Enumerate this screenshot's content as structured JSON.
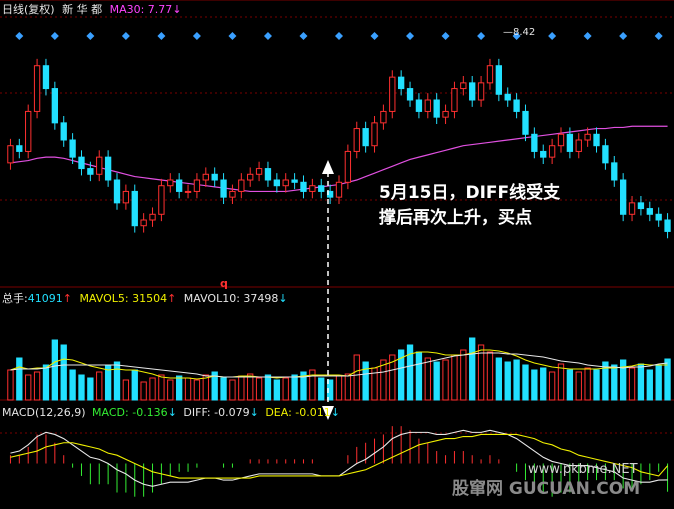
{
  "header": {
    "period": "日线(复权)",
    "stock": "新 华 都",
    "ma_label": "MA30: 7.77",
    "ma_arrow": "↓"
  },
  "vol_header": {
    "total_label": "总手:",
    "total_value": "41091",
    "total_arrow": "↑",
    "mavol5": "MAVOL5: 31504",
    "mavol5_arrow": "↑",
    "mavol10": "MAVOL10: 37498",
    "mavol10_arrow": "↓"
  },
  "macd_header": {
    "params": "MACD(12,26,9)",
    "macd": "MACD: -0.136",
    "macd_arrow": "↓",
    "diff": "DIFF: -0.079",
    "diff_arrow": "↓",
    "dea": "DEA: -0.011",
    "dea_arrow": "↓"
  },
  "annotation": {
    "line1": "5月15日，DIFF线受支",
    "line2": "撑后再次上升，买点"
  },
  "price_high_label": "8.42",
  "marker_q": "q",
  "watermark": {
    "site": "www.pkbme.NET",
    "brand": "股窜网 GUCUAN.COM"
  },
  "colors": {
    "bg": "#000000",
    "up": "#ff3030",
    "down": "#22e0ff",
    "ma30": "#e050e0",
    "diff": "#e8e8e8",
    "dea": "#f0f000",
    "mavol5": "#f0f000",
    "mavol10": "#e8e8e8",
    "grid": "#7a0000",
    "macd_neg": "#33ee33",
    "macd_pos": "#ff3030"
  },
  "chart_data": {
    "type": "candlestick",
    "price": {
      "open": [
        7.45,
        7.6,
        7.55,
        7.9,
        8.3,
        8.1,
        7.8,
        7.65,
        7.5,
        7.4,
        7.35,
        7.5,
        7.3,
        7.1,
        7.2,
        6.9,
        6.95,
        7.0,
        7.25,
        7.3,
        7.2,
        7.2,
        7.3,
        7.35,
        7.3,
        7.15,
        7.2,
        7.3,
        7.35,
        7.4,
        7.3,
        7.25,
        7.3,
        7.28,
        7.2,
        7.25,
        7.2,
        7.15,
        7.28,
        7.55,
        7.75,
        7.6,
        7.8,
        7.9,
        8.2,
        8.1,
        8.0,
        7.9,
        8.0,
        7.85,
        7.9,
        8.1,
        8.15,
        8.0,
        8.15,
        8.3,
        8.05,
        8.0,
        7.9,
        7.7,
        7.55,
        7.5,
        7.6,
        7.7,
        7.55,
        7.65,
        7.7,
        7.6,
        7.45,
        7.3,
        7.0,
        7.1,
        7.05,
        7.0,
        6.95
      ],
      "close": [
        7.6,
        7.55,
        7.9,
        8.3,
        8.1,
        7.8,
        7.65,
        7.5,
        7.4,
        7.35,
        7.5,
        7.3,
        7.1,
        7.2,
        6.9,
        6.95,
        7.0,
        7.25,
        7.3,
        7.2,
        7.2,
        7.3,
        7.35,
        7.3,
        7.15,
        7.2,
        7.3,
        7.35,
        7.4,
        7.3,
        7.25,
        7.3,
        7.28,
        7.2,
        7.25,
        7.2,
        7.15,
        7.28,
        7.55,
        7.75,
        7.6,
        7.8,
        7.9,
        8.2,
        8.1,
        8.0,
        7.9,
        8.0,
        7.85,
        7.9,
        8.1,
        8.15,
        8.0,
        8.15,
        8.3,
        8.05,
        8.0,
        7.9,
        7.7,
        7.55,
        7.5,
        7.6,
        7.7,
        7.55,
        7.65,
        7.7,
        7.6,
        7.45,
        7.3,
        7.0,
        7.1,
        7.05,
        7.0,
        6.95,
        6.85
      ],
      "ma30": [
        7.45,
        7.46,
        7.47,
        7.49,
        7.5,
        7.5,
        7.49,
        7.47,
        7.45,
        7.43,
        7.41,
        7.39,
        7.37,
        7.35,
        7.33,
        7.32,
        7.31,
        7.3,
        7.29,
        7.28,
        7.27,
        7.26,
        7.25,
        7.24,
        7.23,
        7.22,
        7.21,
        7.2,
        7.2,
        7.2,
        7.2,
        7.2,
        7.21,
        7.22,
        7.23,
        7.24,
        7.25,
        7.26,
        7.28,
        7.3,
        7.33,
        7.36,
        7.39,
        7.42,
        7.45,
        7.48,
        7.5,
        7.52,
        7.54,
        7.56,
        7.58,
        7.6,
        7.61,
        7.62,
        7.63,
        7.64,
        7.65,
        7.66,
        7.67,
        7.68,
        7.69,
        7.7,
        7.71,
        7.72,
        7.73,
        7.74,
        7.75,
        7.75,
        7.76,
        7.76,
        7.77,
        7.77,
        7.77,
        7.77,
        7.77
      ],
      "ylim": [
        6.6,
        8.7
      ],
      "high_label_value": 8.42,
      "high_label_index": 52
    },
    "volume": {
      "values": [
        30,
        42,
        25,
        28,
        35,
        60,
        55,
        30,
        25,
        22,
        28,
        35,
        38,
        20,
        30,
        18,
        22,
        25,
        20,
        24,
        22,
        20,
        25,
        28,
        22,
        20,
        24,
        26,
        22,
        25,
        20,
        22,
        25,
        28,
        30,
        22,
        20,
        24,
        26,
        45,
        38,
        32,
        40,
        45,
        50,
        55,
        48,
        42,
        38,
        40,
        45,
        50,
        62,
        55,
        48,
        42,
        38,
        40,
        35,
        30,
        32,
        28,
        36,
        30,
        28,
        32,
        30,
        38,
        35,
        40,
        32,
        36,
        30,
        34,
        41
      ],
      "mavol5": [
        30,
        33,
        31,
        32,
        32,
        38,
        41,
        40,
        37,
        34,
        32,
        30,
        31,
        30,
        30,
        28,
        26,
        23,
        22,
        22,
        22,
        21,
        22,
        24,
        23,
        23,
        24,
        24,
        23,
        23,
        22,
        23,
        23,
        24,
        25,
        25,
        25,
        25,
        24,
        29,
        31,
        32,
        35,
        38,
        42,
        46,
        48,
        48,
        47,
        45,
        45,
        45,
        47,
        50,
        50,
        49,
        47,
        44,
        40,
        37,
        35,
        33,
        32,
        31,
        31,
        31,
        31,
        32,
        32,
        33,
        34,
        36,
        35,
        35,
        35
      ],
      "mavol10": [
        30,
        31,
        31,
        31,
        32,
        34,
        35,
        35,
        35,
        35,
        35,
        35,
        35,
        34,
        33,
        32,
        31,
        30,
        29,
        28,
        27,
        26,
        24,
        24,
        23,
        23,
        23,
        23,
        23,
        23,
        23,
        23,
        23,
        23,
        24,
        24,
        24,
        24,
        24,
        25,
        26,
        27,
        28,
        30,
        32,
        34,
        36,
        38,
        40,
        42,
        44,
        45,
        46,
        47,
        47,
        47,
        46,
        46,
        45,
        44,
        43,
        41,
        39,
        38,
        37,
        35,
        34,
        33,
        33,
        32,
        33,
        33,
        34,
        36,
        37
      ],
      "ylim": [
        0,
        70
      ]
    },
    "macd": {
      "diff": [
        0.05,
        0.06,
        0.09,
        0.13,
        0.15,
        0.14,
        0.12,
        0.09,
        0.06,
        0.03,
        0.02,
        0.0,
        -0.03,
        -0.05,
        -0.08,
        -0.1,
        -0.11,
        -0.1,
        -0.09,
        -0.09,
        -0.09,
        -0.08,
        -0.07,
        -0.07,
        -0.08,
        -0.08,
        -0.07,
        -0.06,
        -0.05,
        -0.05,
        -0.05,
        -0.05,
        -0.05,
        -0.05,
        -0.05,
        -0.06,
        -0.06,
        -0.06,
        -0.03,
        0.0,
        0.02,
        0.05,
        0.08,
        0.12,
        0.14,
        0.15,
        0.15,
        0.15,
        0.14,
        0.14,
        0.15,
        0.16,
        0.15,
        0.15,
        0.16,
        0.15,
        0.14,
        0.12,
        0.09,
        0.06,
        0.03,
        0.01,
        0.0,
        -0.01,
        -0.01,
        -0.01,
        -0.02,
        -0.03,
        -0.04,
        -0.07,
        -0.08,
        -0.09,
        -0.09,
        -0.08,
        -0.079
      ],
      "dea": [
        0.03,
        0.04,
        0.05,
        0.06,
        0.08,
        0.09,
        0.1,
        0.1,
        0.09,
        0.08,
        0.07,
        0.05,
        0.04,
        0.02,
        0.0,
        -0.02,
        -0.04,
        -0.05,
        -0.06,
        -0.07,
        -0.07,
        -0.07,
        -0.07,
        -0.07,
        -0.07,
        -0.07,
        -0.07,
        -0.07,
        -0.06,
        -0.06,
        -0.06,
        -0.06,
        -0.06,
        -0.06,
        -0.06,
        -0.06,
        -0.06,
        -0.06,
        -0.05,
        -0.04,
        -0.03,
        -0.01,
        0.01,
        0.03,
        0.05,
        0.07,
        0.09,
        0.1,
        0.11,
        0.12,
        0.12,
        0.13,
        0.13,
        0.14,
        0.14,
        0.14,
        0.14,
        0.14,
        0.13,
        0.12,
        0.1,
        0.09,
        0.07,
        0.06,
        0.04,
        0.03,
        0.02,
        0.01,
        0.0,
        -0.01,
        -0.02,
        -0.04,
        -0.05,
        -0.06,
        -0.011
      ],
      "ylim": [
        -0.2,
        0.2
      ]
    }
  }
}
